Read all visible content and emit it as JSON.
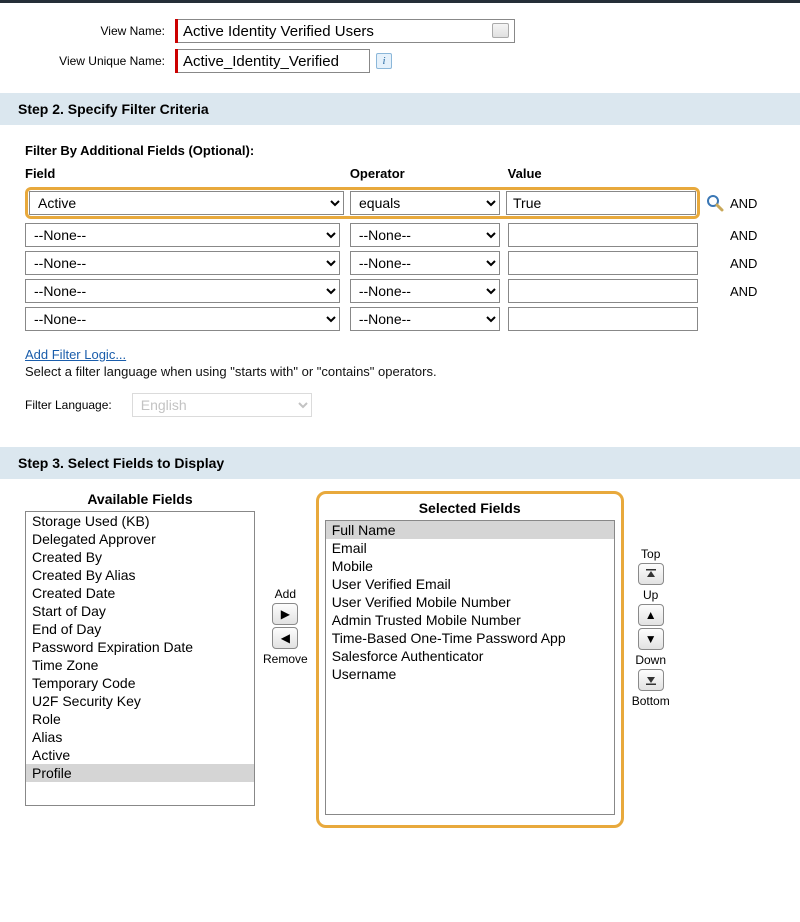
{
  "viewNameLabel": "View Name:",
  "viewName": "Active Identity Verified Users",
  "viewUniqueLabel": "View Unique Name:",
  "viewUnique": "Active_Identity_Verified",
  "step2": {
    "title": "Step 2. Specify Filter Criteria",
    "subhead": "Filter By Additional Fields (Optional):",
    "headers": {
      "field": "Field",
      "operator": "Operator",
      "value": "Value"
    },
    "rows": [
      {
        "field": "Active",
        "operator": "equals",
        "value": "True",
        "highlight": true,
        "lookup": true,
        "and": true
      },
      {
        "field": "--None--",
        "operator": "--None--",
        "value": "",
        "and": true
      },
      {
        "field": "--None--",
        "operator": "--None--",
        "value": "",
        "and": true
      },
      {
        "field": "--None--",
        "operator": "--None--",
        "value": "",
        "and": true
      },
      {
        "field": "--None--",
        "operator": "--None--",
        "value": ""
      }
    ],
    "andLabel": "AND",
    "addFilterLogic": "Add Filter Logic...",
    "hint": "Select a filter language when using \"starts with\" or \"contains\" operators.",
    "filterLangLabel": "Filter Language:",
    "filterLang": "English"
  },
  "step3": {
    "title": "Step 3. Select Fields to Display",
    "availableTitle": "Available Fields",
    "selectedTitle": "Selected Fields",
    "available": [
      "Storage Used (KB)",
      "Delegated Approver",
      "Created By",
      "Created By Alias",
      "Created Date",
      "Start of Day",
      "End of Day",
      "Password Expiration Date",
      "Time Zone",
      "Temporary Code",
      "U2F Security Key",
      "Role",
      "Alias",
      "Active",
      "Profile"
    ],
    "availableSelected": "Profile",
    "selected": [
      "Full Name",
      "Email",
      "Mobile",
      "User Verified Email",
      "User Verified Mobile Number",
      "Admin Trusted Mobile Number",
      "Time-Based One-Time Password App",
      "Salesforce Authenticator",
      "Username"
    ],
    "selectedSelected": "Full Name",
    "buttons": {
      "add": "Add",
      "remove": "Remove",
      "top": "Top",
      "up": "Up",
      "down": "Down",
      "bottom": "Bottom"
    }
  }
}
